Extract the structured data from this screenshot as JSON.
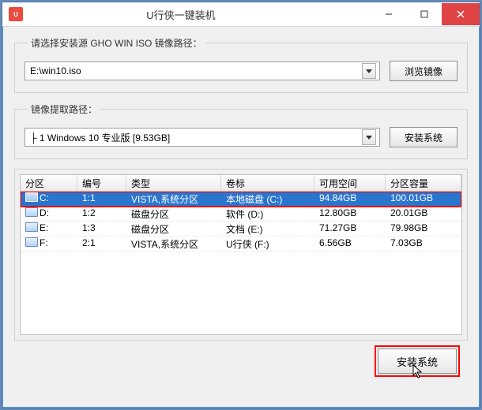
{
  "window_title": "U行侠一键装机",
  "group1": {
    "legend": "请选择安装源 GHO WIN ISO 镜像路径：",
    "value": "E:\\win10.iso",
    "browse_label": "浏览镜像"
  },
  "group2": {
    "legend": "镜像提取路径：",
    "value": "├ 1 Windows 10 专业版 [9.53GB]",
    "install_label": "安装系统"
  },
  "table": {
    "headers": [
      "分区",
      "编号",
      "类型",
      "卷标",
      "可用空间",
      "分区容量"
    ],
    "rows": [
      {
        "partition": "C:",
        "index": "1:1",
        "type": "VISTA,系统分区",
        "label": "本地磁盘 (C:)",
        "free": "94.84GB",
        "total": "100.01GB",
        "selected": true
      },
      {
        "partition": "D:",
        "index": "1:2",
        "type": "磁盘分区",
        "label": "软件 (D:)",
        "free": "12.80GB",
        "total": "20.01GB",
        "selected": false
      },
      {
        "partition": "E:",
        "index": "1:3",
        "type": "磁盘分区",
        "label": "文档 (E:)",
        "free": "71.27GB",
        "total": "79.98GB",
        "selected": false
      },
      {
        "partition": "F:",
        "index": "2:1",
        "type": "VISTA,系统分区",
        "label": "U行侠 (F:)",
        "free": "6.56GB",
        "total": "7.03GB",
        "selected": false
      }
    ]
  },
  "bottom": {
    "install_label": "安装系统"
  }
}
